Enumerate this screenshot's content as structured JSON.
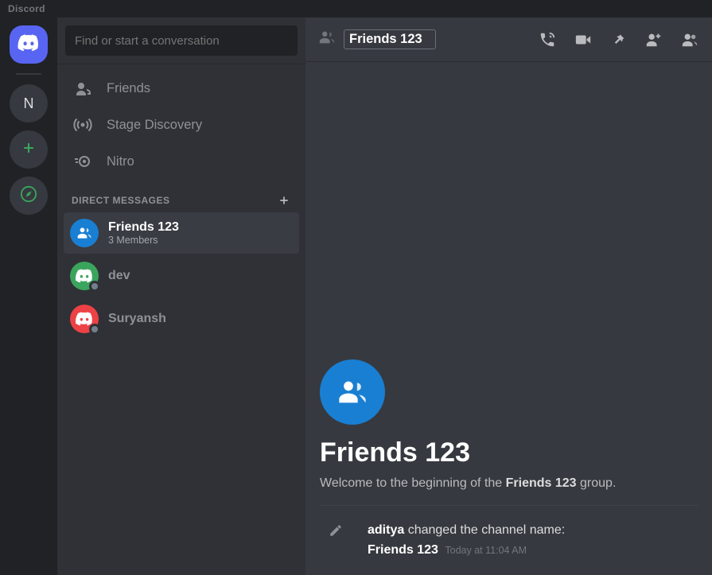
{
  "titlebar": {
    "app_name": "Discord"
  },
  "rail": {
    "server_letter": "N"
  },
  "dm_sidebar": {
    "search_placeholder": "Find or start a conversation",
    "nav": {
      "friends": "Friends",
      "stage": "Stage Discovery",
      "nitro": "Nitro"
    },
    "dm_heading": "DIRECT MESSAGES",
    "items": [
      {
        "name": "Friends 123",
        "subtitle": "3 Members",
        "kind": "group",
        "selected": true
      },
      {
        "name": "dev",
        "kind": "user",
        "color": "green"
      },
      {
        "name": "Suryansh",
        "kind": "user",
        "color": "red"
      }
    ]
  },
  "chat": {
    "header": {
      "title_value": "Friends 123"
    },
    "welcome": {
      "title": "Friends 123",
      "prefix": "Welcome to the beginning of the ",
      "group_name": "Friends 123",
      "suffix": " group."
    },
    "system_message": {
      "actor": "aditya",
      "action_text": " changed the channel name: ",
      "new_name": "Friends 123",
      "timestamp": "Today at 11:04 AM"
    }
  }
}
